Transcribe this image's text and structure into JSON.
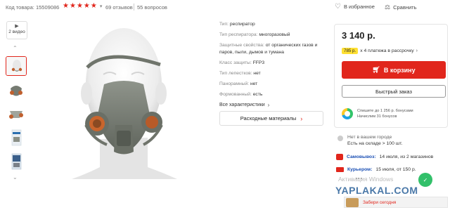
{
  "product": {
    "code_label": "Код товара: 15509086",
    "rating_stars": 5,
    "reviews": "69 отзывов",
    "questions": "55 вопросов",
    "favorites": "В избранное",
    "compare": "Сравнить"
  },
  "gallery": {
    "video_label": "2 видео",
    "thumbnails": [
      "thumb-1",
      "thumb-2",
      "thumb-3",
      "thumb-4",
      "thumb-5"
    ]
  },
  "specs": [
    {
      "label": "Тип:",
      "value": "респиратор"
    },
    {
      "label": "Тип респиратора:",
      "value": "многоразовый"
    },
    {
      "label": "Защитные свойства:",
      "value": "от органических газов и паров, пыли, дымов и тумана"
    },
    {
      "label": "Класс защиты:",
      "value": "FFP3"
    },
    {
      "label": "Тип лепестков:",
      "value": "нет"
    },
    {
      "label": "Панорамный:",
      "value": "нет"
    },
    {
      "label": "Формованный:",
      "value": "есть"
    }
  ],
  "all_specs": "Все характеристики",
  "consumables": "Расходные материалы",
  "buybox": {
    "price": "3 140 р.",
    "installment_badge": "785 р.",
    "installment_text": "х 4 платежа в рассрочку",
    "cart_button": "В корзину",
    "quick_order": "Быстрый заказ",
    "bonus_line1": "Спишите до 1 256 р. бонусами",
    "bonus_line2": "Начислим 31 бонусов"
  },
  "stock": {
    "line1": "Нет в вашем городе",
    "line2": "Есть на складе > 100 шт."
  },
  "delivery": {
    "pickup_label": "Самовывоз:",
    "pickup_text": "14 июля, из 2 магазинов",
    "courier_label": "Курьером:",
    "courier_text": "15 июля, от 150 р."
  },
  "overlay": {
    "watermark": "Активация Windows",
    "logo": "YAPLAKAL.COM",
    "reward_text": "Забери сегодня"
  },
  "colors": {
    "accent": "#e1261c",
    "link_blue": "#1a4fb4",
    "badge_yellow": "#ffe033",
    "chat_green": "#32c06a"
  }
}
